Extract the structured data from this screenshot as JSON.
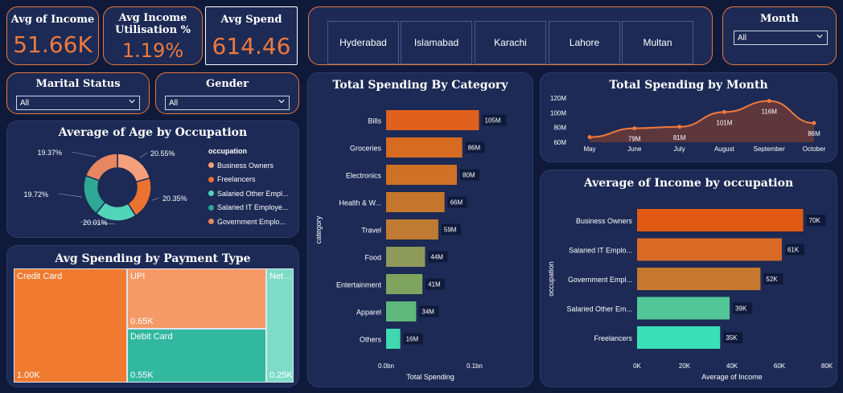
{
  "kpis": {
    "income": {
      "label": "Avg of Income",
      "value": "51.66K"
    },
    "util": {
      "label": "Avg Income Utilisation %",
      "value": "1.19%"
    },
    "spend": {
      "label": "Avg Spend",
      "value": "614.46"
    }
  },
  "cities": [
    "Hyderabad",
    "Islamabad",
    "Karachi",
    "Lahore",
    "Multan"
  ],
  "filters": {
    "month": {
      "label": "Month",
      "value": "All"
    },
    "marital": {
      "label": "Marital Status",
      "value": "All"
    },
    "gender": {
      "label": "Gender",
      "value": "All"
    }
  },
  "colors": {
    "orange": "#ef7a3d",
    "teal": "#35c4a4",
    "peach": "#f5a07c",
    "dark_orange": "#e66a1e",
    "bg": "#0f1a3a",
    "card": "#1c2a55"
  },
  "donut": {
    "title": "Average of Age by Occupation",
    "legend_title": "occupation",
    "slices": [
      {
        "name": "Business Owners",
        "pct": "20.55%",
        "value": 20.55,
        "color": "#f5a07c"
      },
      {
        "name": "Freelancers",
        "pct": "20.35%",
        "value": 20.35,
        "color": "#ec7232"
      },
      {
        "name": "Salaried Other Empl...",
        "pct": "20.01%",
        "value": 20.01,
        "color": "#52d4b8"
      },
      {
        "name": "Salaried IT Employe...",
        "pct": "19.72%",
        "value": 19.72,
        "color": "#2ea894"
      },
      {
        "name": "Government Emplo...",
        "pct": "19.37%",
        "value": 19.37,
        "color": "#e8865f"
      }
    ]
  },
  "treemap": {
    "title": "Avg Spending by Payment Type",
    "cells": [
      {
        "name": "Credit Card",
        "value": "1.00K",
        "color": "#ef7a30"
      },
      {
        "name": "UPI",
        "value": "0.65K",
        "color": "#f59a66"
      },
      {
        "name": "Debit Card",
        "value": "0.55K",
        "color": "#33b8a0"
      },
      {
        "name": "Net...",
        "value": "0.25K",
        "color": "#7ddcc8"
      }
    ]
  },
  "chart_data": [
    {
      "type": "bar",
      "orientation": "horizontal",
      "title": "Total Spending By Category",
      "xlabel": "Total Spending",
      "ylabel": "category",
      "categories": [
        "Bills",
        "Groceries",
        "Electronics",
        "Health & W...",
        "Travel",
        "Food",
        "Entertainment",
        "Apparel",
        "Others"
      ],
      "values": [
        105,
        86,
        80,
        66,
        59,
        44,
        41,
        34,
        16
      ],
      "labels": [
        "105M",
        "86M",
        "80M",
        "66M",
        "59M",
        "44M",
        "41M",
        "34M",
        "16M"
      ],
      "colors": [
        "#e0611d",
        "#d76b22",
        "#cf7027",
        "#c6752c",
        "#bf7b33",
        "#8d9a5a",
        "#7fa45f",
        "#5fb77a",
        "#40d8b0"
      ],
      "xticks": [
        "0.0bn",
        "0.1bn"
      ],
      "xlim": [
        0,
        100
      ]
    },
    {
      "type": "area",
      "title": "Total Spending by Month",
      "categories": [
        "May",
        "June",
        "July",
        "August",
        "September",
        "October"
      ],
      "values": [
        67,
        79,
        81,
        101,
        116,
        86
      ],
      "labels": [
        "",
        "79M",
        "81M",
        "101M",
        "116M",
        "86M"
      ],
      "yticks": [
        "120M",
        "100M",
        "80M",
        "60M"
      ],
      "ylim": [
        60,
        120
      ]
    },
    {
      "type": "bar",
      "orientation": "horizontal",
      "title": "Average of Income by occupation",
      "xlabel": "Average of Income",
      "ylabel": "occupation",
      "categories": [
        "Business Owners",
        "Salaried IT Emplo...",
        "Government Empl...",
        "Salaried Other Em...",
        "Freelancers"
      ],
      "values": [
        70,
        61,
        52,
        39,
        35
      ],
      "labels": [
        "70K",
        "61K",
        "52K",
        "39K",
        "35K"
      ],
      "colors": [
        "#e05a14",
        "#d86a25",
        "#c7782f",
        "#52c697",
        "#3ae0b6"
      ],
      "xticks": [
        "0K",
        "20K",
        "40K",
        "60K",
        "80K"
      ],
      "xlim": [
        0,
        80
      ]
    }
  ]
}
